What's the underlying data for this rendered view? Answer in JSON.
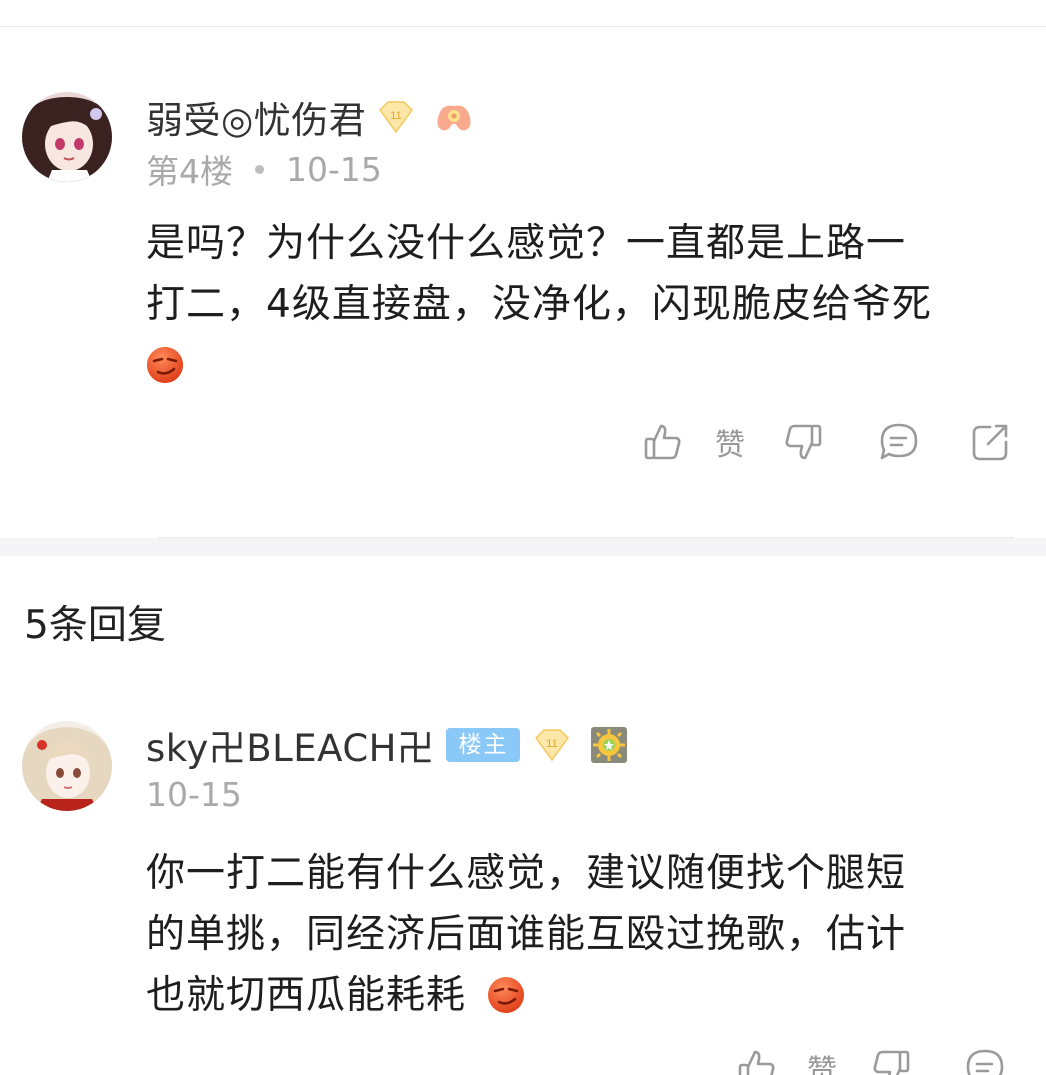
{
  "post": {
    "username": "弱受◎忧伤君",
    "level": "11",
    "floor": "第4楼",
    "date": "10-15",
    "content_line1": "是吗？为什么没什么感觉？一直都是上路一",
    "content_line2": "打二，4级直接盘，没净化，闪现脆皮给爷死",
    "like_label": "赞"
  },
  "replies": {
    "title": "5条回复",
    "items": [
      {
        "username": "sky卍BLEACH卍",
        "owner_badge": "楼主",
        "level": "11",
        "date": "10-15",
        "content_line1": "你一打二能有什么感觉，建议随便找个腿短",
        "content_line2": "的单挑，同经济后面谁能互殴过挽歌，估计",
        "content_line3": "也就切西瓜能耗耗",
        "like_label": "赞"
      }
    ]
  },
  "colors": {
    "accent_badge": "#8ac9f7",
    "meta_text": "#a9a9a9",
    "icon_gray": "#9a9a9a"
  },
  "icons": [
    "thumbs-up-icon",
    "thumbs-down-icon",
    "comment-icon",
    "share-icon",
    "level-gem-icon",
    "gamepad-icon",
    "sun-badge-icon",
    "smirk-emoji-icon"
  ]
}
